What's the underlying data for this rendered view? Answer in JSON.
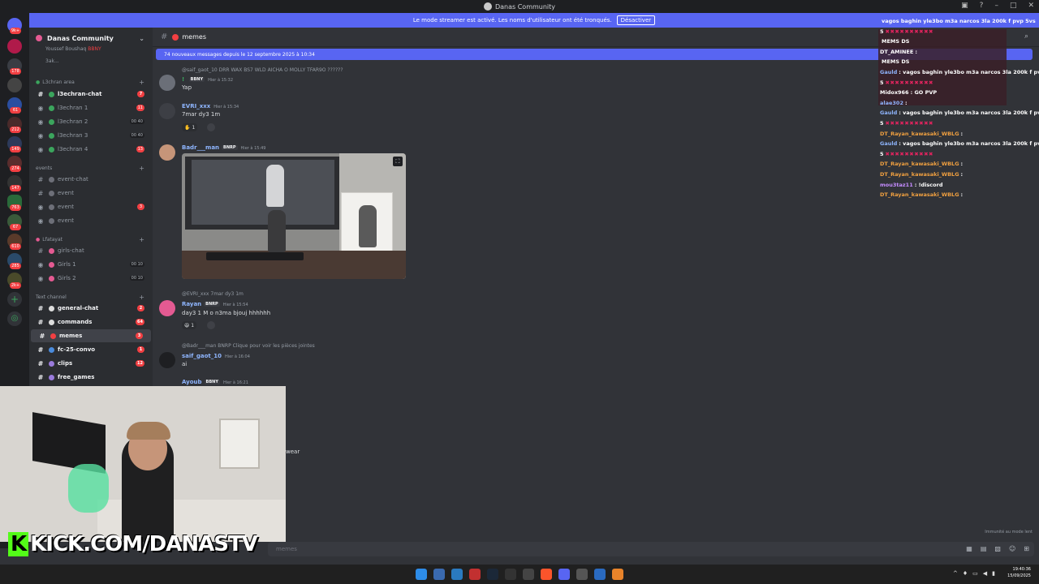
{
  "window": {
    "title": "Danas Community"
  },
  "banner": {
    "text": "Le mode streamer est activé. Les noms d'utilisateur ont été tronqués.",
    "button": "Désactiver"
  },
  "rail": {
    "badges": [
      "9k+",
      "178",
      "61",
      "212",
      "149",
      "274",
      "147",
      "763",
      "67",
      "610",
      "285",
      "2k+"
    ]
  },
  "sidebar": {
    "server_name": "Danas Community",
    "voice_users": [
      "Youssef Boushaq",
      "BBNY",
      "3ak..."
    ],
    "categories": [
      {
        "label": "L3chran area"
      },
      {
        "label": "events"
      },
      {
        "label": "Lfatayat"
      },
      {
        "label": "Text channel"
      }
    ],
    "channels": [
      {
        "label": "l3echran-chat",
        "badge": "7"
      },
      {
        "label": "l3echran 1",
        "badge": "11"
      },
      {
        "label": "l3echran 2",
        "vc": "00 40"
      },
      {
        "label": "l3echran 3",
        "vc": "00 40"
      },
      {
        "label": "l3echran 4",
        "badge": "13"
      },
      {
        "label": "event-chat"
      },
      {
        "label": "event"
      },
      {
        "label": "event",
        "badge": "3"
      },
      {
        "label": "event"
      },
      {
        "label": "girls-chat"
      },
      {
        "label": "Girls 1",
        "vc": "00 10"
      },
      {
        "label": "Girls 2",
        "vc": "00 10"
      },
      {
        "label": "general-chat",
        "badge": "2"
      },
      {
        "label": "commands",
        "badge": "64"
      },
      {
        "label": "memes",
        "badge": "3"
      },
      {
        "label": "fc-25-convo",
        "badge": "1"
      },
      {
        "label": "clips",
        "badge": "12"
      },
      {
        "label": "free_games",
        "badge": ""
      }
    ]
  },
  "header": {
    "channel": "memes"
  },
  "newbar": {
    "text": "74 nouveaux messages depuis le 12 septembre 2025 à 10:34"
  },
  "messages": [
    {
      "reply": "@saif_gaot_10 DRR WAX BS7 WLD AICHA O MOLLY TFAR9O ??????",
      "user": "! ",
      "tag": "BBNY",
      "time": "Hier à 15:32",
      "text": "Yap"
    },
    {
      "user": "EVRI_xxx",
      "time": "Hier à 15:34",
      "text": "7mar dy3 1m",
      "reaction": "1"
    },
    {
      "user": "Badr___man",
      "tag": "BNRP",
      "time": "Hier à 15:49"
    },
    {
      "reply": "@EVRI_xxx 7mar dy3 1m",
      "user": "Rayan",
      "tag": "BNRP",
      "time": "Hier à 15:54",
      "text": "day3 1 M o n3ma bjouj hhhhhh",
      "reaction": "1"
    },
    {
      "reply": "@Badr___man BNRP Clique pour voir les pièces jointes",
      "user": "saif_gaot_10",
      "time": "Hier à 16:04",
      "text": "ai"
    },
    {
      "user": "Ayoub",
      "tag": "BBNY",
      "time": "Hier à 16:21"
    }
  ],
  "faded_text": "wear",
  "stream_chat": [
    {
      "user": "",
      "text": "vagos baghin yle3bo m3a narcos 3la 200k f pvp 5vs",
      "color": "#8fb6ff"
    },
    {
      "user": "5",
      "text": "✖✖✖✖✖✖✖✖✖✖",
      "color": "#fff"
    },
    {
      "user": "",
      "text": "MEMS DS",
      "color": "#fff"
    },
    {
      "user": "DT_AMINEE",
      "text": ":",
      "color": "#fff"
    },
    {
      "user": "",
      "text": "MEMS DS",
      "color": "#fff"
    },
    {
      "user": "Gauld",
      "text": ": vagos baghin yle3bo m3a narcos 3la 200k f pvp 5vs",
      "color": "#8fb6ff"
    },
    {
      "user": "5",
      "text": "✖✖✖✖✖✖✖✖✖✖",
      "color": "#fff"
    },
    {
      "user": "Midox966",
      "text": ": GO PVP",
      "color": "#fff"
    },
    {
      "user": "alae302",
      "text": ":",
      "color": "#8fb6ff"
    },
    {
      "user": "Gauld",
      "text": ": vagos baghin yle3bo m3a narcos 3la 200k f pvp 5vs",
      "color": "#8fb6ff"
    },
    {
      "user": "5",
      "text": "✖✖✖✖✖✖✖✖✖✖",
      "color": "#fff"
    },
    {
      "user": "DT_Rayan_kawasaki_WBLG",
      "text": ":",
      "color": "#f0a040"
    },
    {
      "user": "Gauld",
      "text": ": vagos baghin yle3bo m3a narcos 3la 200k f pvp 5vs",
      "color": "#8fb6ff"
    },
    {
      "user": "5",
      "text": "✖✖✖✖✖✖✖✖✖✖",
      "color": "#fff"
    },
    {
      "user": "DT_Rayan_kawasaki_WBLG",
      "text": ":",
      "color": "#f0a040"
    },
    {
      "user": "DT_Rayan_kawasaki_WBLG",
      "text": ":",
      "color": "#f0a040"
    },
    {
      "user": "mou3taz11",
      "text": ": !discord",
      "color": "#c58cff"
    },
    {
      "user": "DT_Rayan_kawasaki_WBLG",
      "text": ":",
      "color": "#f0a040"
    }
  ],
  "kick_overlay": {
    "k": "K",
    "text": "KICK.COM/DANASTV"
  },
  "input": {
    "placeholder": "memes"
  },
  "status_hint": "Immunité au mode lent",
  "clock": {
    "time": "19:40:36",
    "date": "15/09/2025"
  },
  "colors": {
    "accent": "#5865f2",
    "badge": "#f23f42",
    "kick_green": "#53fc18"
  }
}
